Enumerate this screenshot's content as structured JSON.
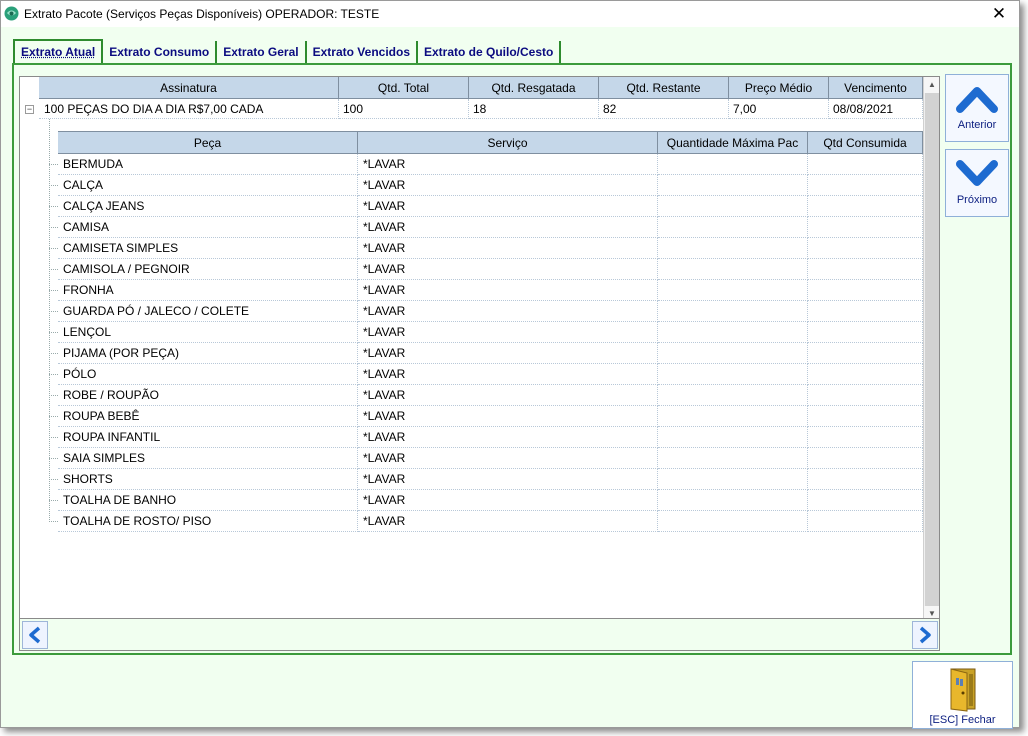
{
  "window": {
    "title": "Extrato Pacote (Serviços Peças Disponíveis) OPERADOR: TESTE",
    "close_glyph": "✕"
  },
  "tabs": [
    {
      "label": "Extrato Atual",
      "active": true
    },
    {
      "label": "Extrato Consumo",
      "active": false
    },
    {
      "label": "Extrato Geral",
      "active": false
    },
    {
      "label": "Extrato Vencidos",
      "active": false
    },
    {
      "label": "Extrato de Quilo/Cesto",
      "active": false
    }
  ],
  "master_grid": {
    "columns": [
      "Assinatura",
      "Qtd. Total",
      "Qtd. Resgatada",
      "Qtd. Restante",
      "Preço Médio",
      "Vencimento"
    ],
    "row": [
      "100 PEÇAS DO DIA A DIA R$7,00 CADA",
      "100",
      "18",
      "82",
      "7,00",
      "08/08/2021"
    ],
    "expander_glyph": "−"
  },
  "detail_grid": {
    "columns": [
      "Peça",
      "Serviço",
      "Quantidade Máxima Pac",
      "Qtd Consumida"
    ],
    "rows": [
      [
        "BERMUDA",
        "*LAVAR",
        "",
        ""
      ],
      [
        "CALÇA",
        "*LAVAR",
        "",
        ""
      ],
      [
        "CALÇA JEANS",
        "*LAVAR",
        "",
        ""
      ],
      [
        "CAMISA",
        "*LAVAR",
        "",
        ""
      ],
      [
        "CAMISETA SIMPLES",
        "*LAVAR",
        "",
        ""
      ],
      [
        "CAMISOLA / PEGNOIR",
        "*LAVAR",
        "",
        ""
      ],
      [
        "FRONHA",
        "*LAVAR",
        "",
        ""
      ],
      [
        "GUARDA PÓ / JALECO / COLETE",
        "*LAVAR",
        "",
        ""
      ],
      [
        "LENÇOL",
        "*LAVAR",
        "",
        ""
      ],
      [
        "PIJAMA (POR PEÇA)",
        "*LAVAR",
        "",
        ""
      ],
      [
        "PÓLO",
        "*LAVAR",
        "",
        ""
      ],
      [
        "ROBE / ROUPÃO",
        "*LAVAR",
        "",
        ""
      ],
      [
        "ROUPA BEBÊ",
        "*LAVAR",
        "",
        ""
      ],
      [
        "ROUPA INFANTIL",
        "*LAVAR",
        "",
        ""
      ],
      [
        "SAIA SIMPLES",
        "*LAVAR",
        "",
        ""
      ],
      [
        "SHORTS",
        "*LAVAR",
        "",
        ""
      ],
      [
        "TOALHA DE BANHO",
        "*LAVAR",
        "",
        ""
      ],
      [
        "TOALHA DE ROSTO/ PISO",
        "*LAVAR",
        "",
        ""
      ]
    ]
  },
  "scrollbar": {
    "up_glyph": "▲",
    "down_glyph": "▼"
  },
  "side_buttons": {
    "previous_label": "Anterior",
    "next_label": "Próximo"
  },
  "footer": {
    "close_label": "[ESC] Fechar"
  },
  "colors": {
    "window_bg": "#f1fff0",
    "tab_border": "#2e8b2e",
    "grid_header": "#c5d7e9",
    "button_label": "#0b1e80",
    "arrow_blue": "#1e6bd0"
  },
  "icons": {
    "app": "app-logo-icon",
    "previous": "chevron-up-icon",
    "next": "chevron-down-icon",
    "scroll_left": "chevron-left-icon",
    "scroll_right": "chevron-right-icon",
    "close_door": "door-exit-icon"
  }
}
